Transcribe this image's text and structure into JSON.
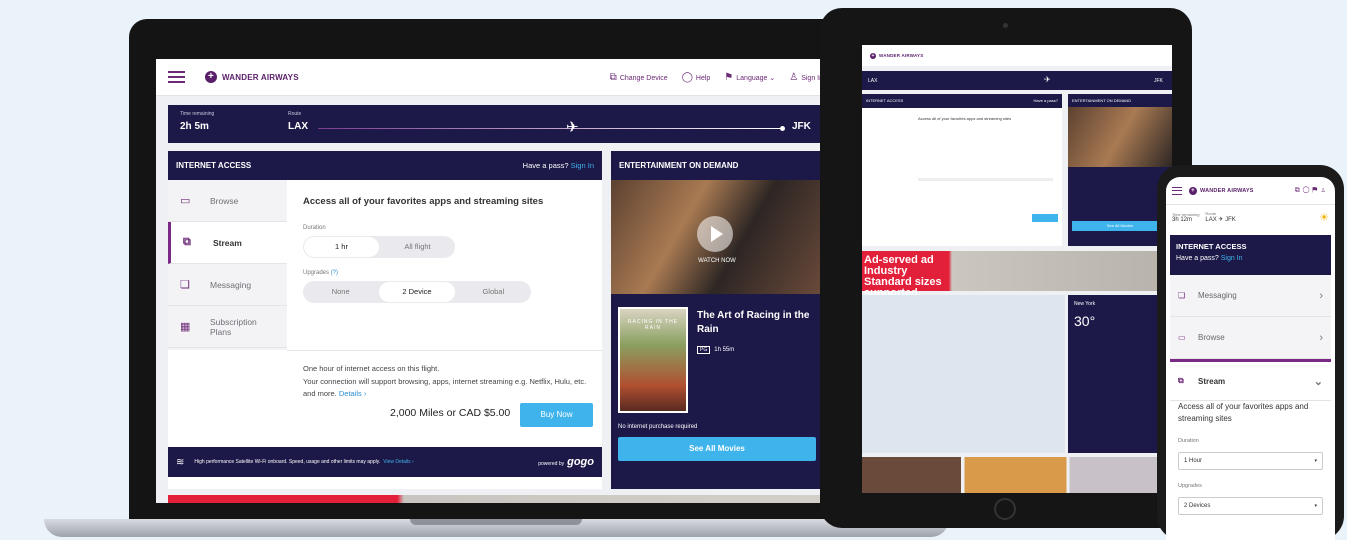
{
  "brand": {
    "name": "WANDER AIRWAYS",
    "accent": "#6b2a76",
    "navy": "#1c1848",
    "cta": "#3fb4ec"
  },
  "topnav": [
    {
      "icon": "devices-icon",
      "label": "Change Device"
    },
    {
      "icon": "chat-icon",
      "label": "Help"
    },
    {
      "icon": "flag-icon",
      "label": "Language ⌄"
    },
    {
      "icon": "user-icon",
      "label": "Sign In"
    }
  ],
  "route": {
    "time_label": "Time remaining",
    "time_value": "2h 5m",
    "route_label": "Route",
    "origin": "LAX",
    "destination": "JFK"
  },
  "internet_access": {
    "title": "INTERNET ACCESS",
    "pass_text": "Have a pass?",
    "pass_link": "Sign In",
    "menu": [
      {
        "icon": "browse-icon",
        "label": "Browse"
      },
      {
        "icon": "stream-icon",
        "label": "Stream"
      },
      {
        "icon": "messaging-icon",
        "label": "Messaging"
      },
      {
        "icon": "calendar-icon",
        "label": "Subscription Plans"
      }
    ],
    "headline": "Access all of your favorites apps and streaming sites",
    "duration_label": "Duration",
    "duration_options": [
      "1 hr",
      "All flight"
    ],
    "upgrades_label": "Upgrades",
    "upgrades_help": "(?)",
    "upgrade_options": [
      "None",
      "2 Device",
      "Global"
    ],
    "description_1": "One hour of internet access on this flight.",
    "description_2": "Your connection will support browsing, apps, internet streaming e.g. Netflix, Hulu, etc. and more.",
    "details_link": "Details ›",
    "price": "2,000 Miles or CAD $5.00",
    "buy_label": "Buy Now",
    "footer_text": "High performance Satellite Wi-Fi onboard. Speed, usage and other limits may apply.",
    "footer_link": "View Details ›",
    "powered_by": "powered by",
    "provider": "gogo"
  },
  "entertainment": {
    "title": "ENTERTAINMENT ON DEMAND",
    "watch_now": "WATCH NOW",
    "poster_text": "RACING IN THE RAIN",
    "movie_title": "The Art of Racing in the Rain",
    "rating": "PG",
    "runtime": "1h 55m",
    "note": "No internet purchase required",
    "see_all": "See All Movies"
  },
  "tablet": {
    "ad_text": "Ad-served ad Industry Standard sizes supported.",
    "weather_city": "New York",
    "weather_temp": "30°"
  },
  "phone": {
    "time_label": "Time remaining",
    "time_value": "3h 12m",
    "route_label": "Route",
    "route_value": "LAX ✈ JFK",
    "ia_title": "INTERNET ACCESS",
    "pass_text": "Have a pass?",
    "pass_link": "Sign In",
    "rows": [
      "Messaging",
      "Browse"
    ],
    "open_row": "Stream",
    "headline": "Access all of your favorites apps and streaming sites",
    "duration_label": "Duration",
    "duration_value": "1 Hour",
    "upgrades_label": "Upgrades",
    "upgrades_value": "2 Devices"
  }
}
